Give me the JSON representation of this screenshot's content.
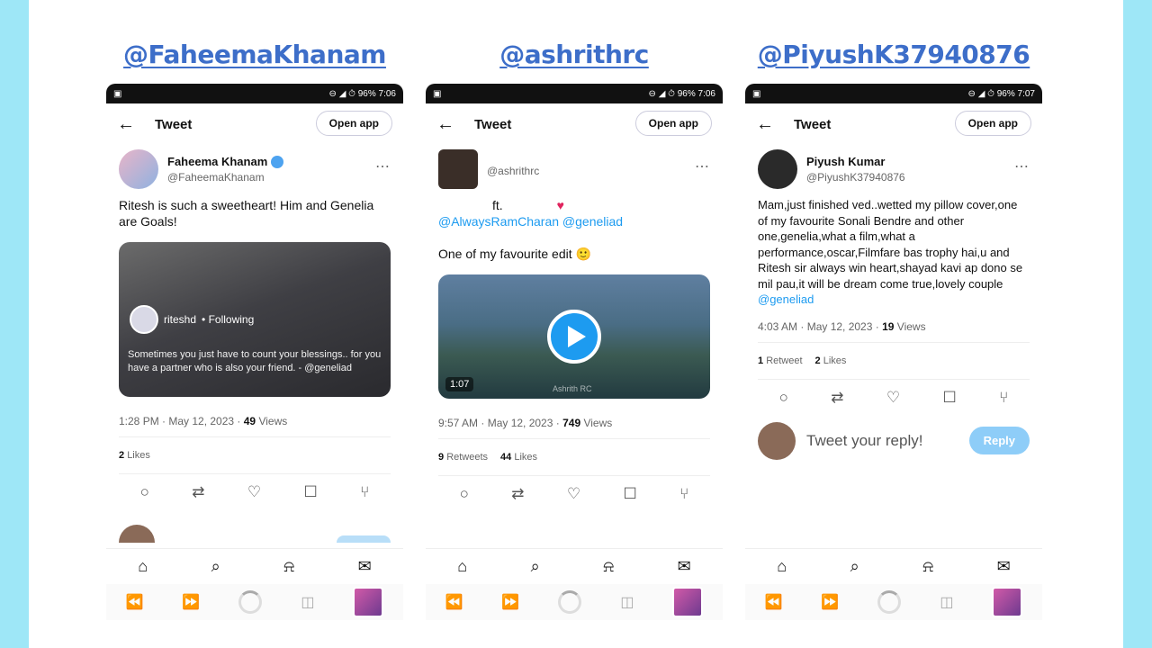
{
  "columns": [
    {
      "handle": "@FaheemaKhanam",
      "status": {
        "left": "▣",
        "right": "⊖ ◢ ⏱ 96% 7:06"
      },
      "topbar": {
        "back": "←",
        "title": "Tweet",
        "open_app": "Open app"
      },
      "author": {
        "name": "Faheema Khanam",
        "handle": "@FaheemaKhanam",
        "more": "⋯"
      },
      "text": "Ritesh is such a sweetheart!  Him and Genelia are Goals!",
      "media": {
        "user": "riteshd",
        "following": "•  Following",
        "caption": "Sometimes you just have to count your blessings.. for you have a partner who is also your friend. - @geneliad"
      },
      "meta": {
        "time": "1:28 PM · May 12, 2023 ·",
        "views_count": "49",
        "views_label": "Views"
      },
      "stats": {
        "likes_count": "2",
        "likes_label": "Likes"
      }
    },
    {
      "handle": "@ashrithrc",
      "status": {
        "left": "▣",
        "right": "⊖ ◢ ⏱ 96% 7:06"
      },
      "topbar": {
        "back": "←",
        "title": "Tweet",
        "open_app": "Open app"
      },
      "author": {
        "name": "",
        "handle": "@ashrithrc",
        "more": "⋯"
      },
      "text_line1": "ft.",
      "heart": "♥",
      "mentions": "@AlwaysRamCharan @geneliad",
      "text2": "One of my favourite edit 🙂",
      "media": {
        "duration": "1:07",
        "watermark": "Ashrith RC"
      },
      "meta": {
        "time": "9:57 AM · May 12, 2023 ·",
        "views_count": "749",
        "views_label": "Views"
      },
      "stats": {
        "retweets_count": "9",
        "retweets_label": "Retweets",
        "likes_count": "44",
        "likes_label": "Likes"
      }
    },
    {
      "handle": "@PiyushK37940876",
      "status": {
        "left": "▣",
        "right": "⊖ ◢ ⏱ 96% 7:07"
      },
      "topbar": {
        "back": "←",
        "title": "Tweet",
        "open_app": "Open app"
      },
      "author": {
        "name": "Piyush Kumar",
        "handle": "@PiyushK37940876",
        "more": "⋯"
      },
      "text": "Mam,just finished ved..wetted my pillow cover,one of my favourite Sonali Bendre and other one,genelia,what a film,what a performance,oscar,Filmfare bas trophy hai,u and Ritesh sir always win heart,shayad kavi ap dono se mil pau,it will be dream come true,lovely couple",
      "mention": "@geneliad",
      "meta": {
        "time": "4:03 AM · May 12, 2023 ·",
        "views_count": "19",
        "views_label": "Views"
      },
      "stats": {
        "retweets_count": "1",
        "retweets_label": "Retweet",
        "likes_count": "2",
        "likes_label": "Likes"
      },
      "reply": {
        "placeholder": "Tweet your reply!",
        "button": "Reply"
      }
    }
  ],
  "icons": {
    "reply": "○",
    "retweet": "⇄",
    "like": "♡",
    "bookmark": "☐",
    "share": "⑂",
    "home": "⌂",
    "search": "⌕",
    "bell": "⍾",
    "mail": "✉",
    "back_nav": "⏪",
    "forward_nav": "⏩",
    "tabs": "◫"
  }
}
